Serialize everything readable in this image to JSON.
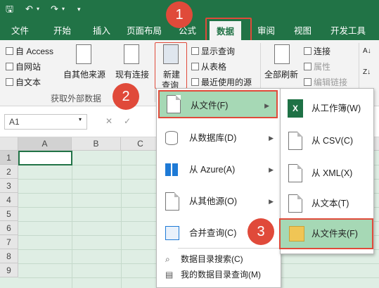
{
  "quick_access": {
    "save_icon": "save-icon",
    "undo_icon": "undo-icon",
    "redo_icon": "redo-icon"
  },
  "tabs": [
    "文件",
    "开始",
    "插入",
    "页面布局",
    "公式",
    "数据",
    "审阅",
    "视图",
    "开发工具"
  ],
  "active_tab": "数据",
  "ribbon": {
    "get_external": {
      "access": "自 Access",
      "web": "自网站",
      "text": "自文本",
      "other_sources": "自其他来源",
      "existing_connections": "现有连接",
      "group_label": "获取外部数据"
    },
    "get_transform": {
      "new_query_line1": "新建",
      "new_query_line2": "查询",
      "show_queries": "显示查询",
      "from_table": "从表格",
      "recent_sources": "最近使用的源"
    },
    "connections": {
      "refresh_all": "全部刷新",
      "connections": "连接",
      "properties": "属性",
      "edit_links": "编辑链接"
    }
  },
  "formula_bar": {
    "name_box": "A1"
  },
  "grid": {
    "columns": [
      "A",
      "B",
      "C"
    ],
    "rows": [
      "1",
      "2",
      "3",
      "4",
      "5",
      "6",
      "7",
      "8",
      "9"
    ]
  },
  "menu_main": {
    "items": [
      "从文件(F)",
      "从数据库(D)",
      "从 Azure(A)",
      "从其他源(O)",
      "合并查询(C)"
    ],
    "small_items": [
      "数据目录搜索(C)",
      "我的数据目录查询(M)"
    ]
  },
  "menu_sub": {
    "items": [
      "从工作簿(W)",
      "从 CSV(C)",
      "从 XML(X)",
      "从文本(T)",
      "从文件夹(F)"
    ]
  },
  "callouts": [
    "1",
    "2",
    "3"
  ],
  "colors": {
    "brand": "#217346",
    "callout": "#e04a3a",
    "highlight": "#a6d8b5",
    "grid_bg": "#dfeee4"
  }
}
